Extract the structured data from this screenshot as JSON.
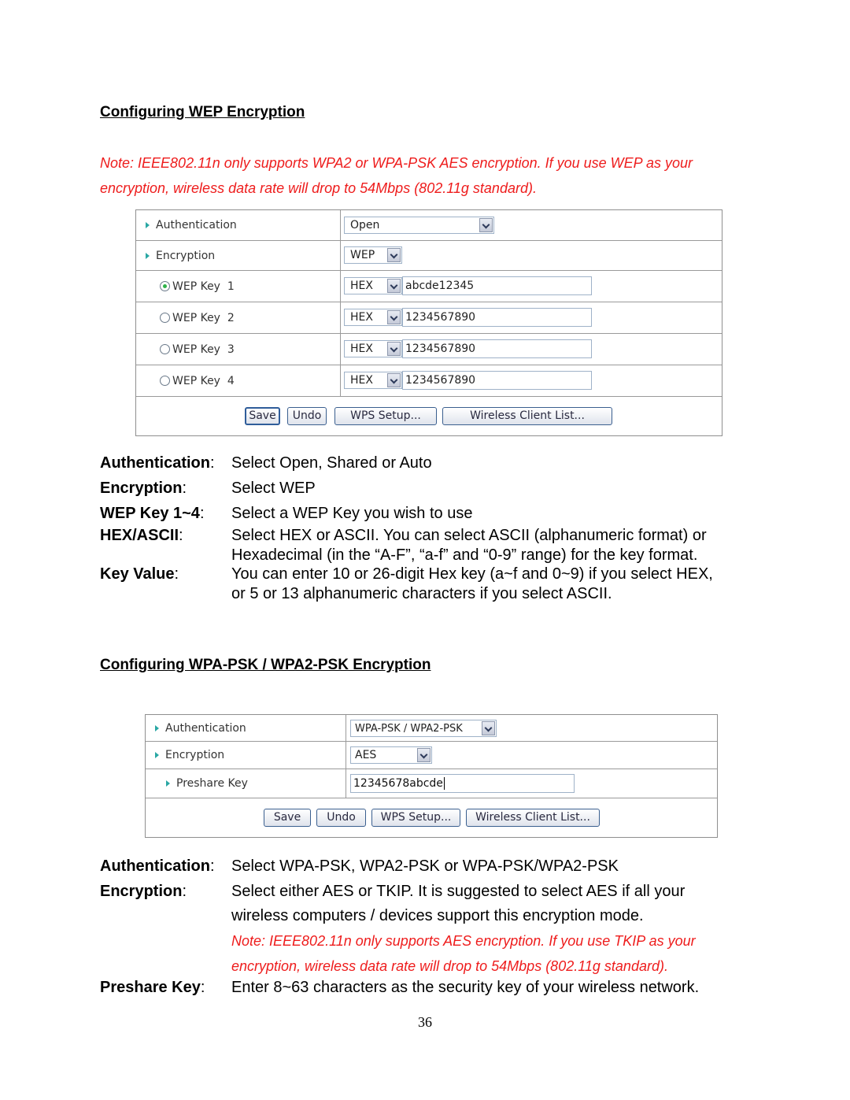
{
  "wep_section": {
    "title": "Configuring WEP Encryption",
    "note_line1": "Note: IEEE802.11n only supports WPA2 or WPA-PSK AES encryption. If you use WEP as your",
    "note_line2": "encryption, wireless data rate will drop to 54Mbps (802.11g standard).",
    "panel": {
      "authentication_label": "Authentication",
      "authentication_value": "Open",
      "encryption_label": "Encryption",
      "encryption_value": "WEP",
      "keys": [
        {
          "label": "WEP Key  1",
          "format": "HEX",
          "value": "abcde12345",
          "selected": true
        },
        {
          "label": "WEP Key  2",
          "format": "HEX",
          "value": "1234567890",
          "selected": false
        },
        {
          "label": "WEP Key  3",
          "format": "HEX",
          "value": "1234567890",
          "selected": false
        },
        {
          "label": "WEP Key  4",
          "format": "HEX",
          "value": "1234567890",
          "selected": false
        }
      ],
      "buttons": {
        "save": "Save",
        "undo": "Undo",
        "wps_setup": "WPS Setup...",
        "wireless_client_list": "Wireless Client List..."
      }
    },
    "descriptions": [
      {
        "label": "Authentication",
        "colon": ":",
        "text": [
          "Select Open, Shared or Auto"
        ]
      },
      {
        "label": "Encryption",
        "colon": ":",
        "text": [
          "Select WEP"
        ]
      },
      {
        "label": "WEP Key 1~4",
        "colon": ":",
        "text": [
          "Select a WEP Key you wish to use"
        ]
      },
      {
        "label": "HEX/ASCII",
        "colon": ":",
        "text": [
          "Select HEX or ASCII. You can select ASCII (alphanumeric format) or",
          "Hexadecimal (in the “A-F”, “a-f” and “0-9” range) for the key format."
        ]
      },
      {
        "label": "Key Value",
        "colon": ":",
        "text": [
          "You can enter 10 or 26-digit Hex key (a~f and 0~9) if you select HEX,",
          "or 5 or 13 alphanumeric characters if you select ASCII."
        ]
      }
    ]
  },
  "wpa_section": {
    "title": "Configuring WPA-PSK / WPA2-PSK Encryption",
    "panel": {
      "authentication_label": "Authentication",
      "authentication_value": "WPA-PSK / WPA2-PSK",
      "encryption_label": "Encryption",
      "encryption_value": "AES",
      "preshare_label": "Preshare Key",
      "preshare_value": "12345678abcde",
      "buttons": {
        "save": "Save",
        "undo": "Undo",
        "wps_setup": "WPS Setup...",
        "wireless_client_list": "Wireless Client List..."
      }
    },
    "descriptions": [
      {
        "label": "Authentication",
        "colon": ":",
        "text": [
          "Select WPA-PSK, WPA2-PSK or WPA-PSK/WPA2-PSK"
        ]
      },
      {
        "label": "Encryption",
        "colon": ":",
        "text": [
          "Select either AES or TKIP. It is suggested to select AES if all your",
          "wireless computers / devices support this encryption mode."
        ]
      },
      {
        "label": "Preshare Key",
        "colon": ":",
        "text": [
          "Enter 8~63 characters as the security key of your wireless network."
        ]
      }
    ],
    "note_line1": "Note: IEEE802.11n only supports AES encryption. If you use TKIP as your",
    "note_line2": "encryption, wireless data rate will drop to 54Mbps (802.11g standard)."
  },
  "page_number": "36",
  "colors": {
    "note_red": "#ee1c1c",
    "arrow_teal": "#2aa7a4",
    "radio_green": "#2fb24a"
  }
}
